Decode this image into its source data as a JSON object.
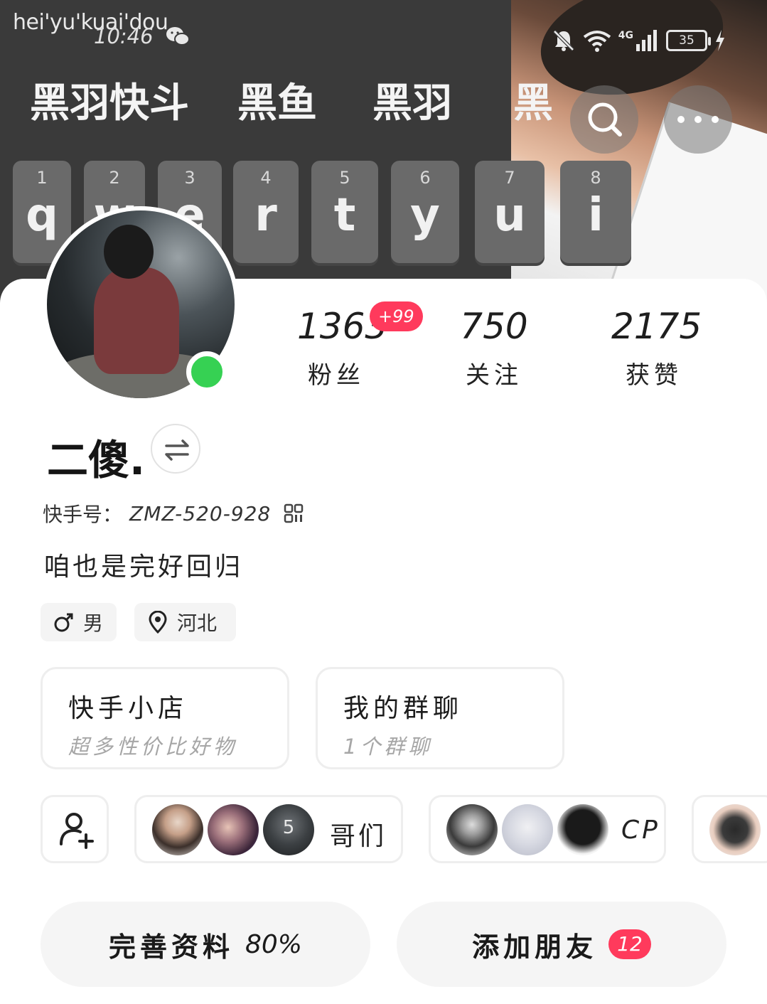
{
  "status_bar": {
    "carrier": "hei'yu'kuai'dou",
    "time": "10:46",
    "network": "4G",
    "battery": "35"
  },
  "header": {
    "hot_words": [
      "黑羽快斗",
      "黑鱼",
      "黑羽",
      "黑"
    ],
    "keyboard": [
      {
        "num": "1",
        "ch": "q"
      },
      {
        "num": "2",
        "ch": "w"
      },
      {
        "num": "3",
        "ch": "e"
      },
      {
        "num": "4",
        "ch": "r"
      },
      {
        "num": "5",
        "ch": "t"
      },
      {
        "num": "6",
        "ch": "y"
      },
      {
        "num": "7",
        "ch": "u"
      },
      {
        "num": "8",
        "ch": "i"
      }
    ]
  },
  "profile": {
    "stats": {
      "fans": {
        "value": "1363",
        "label": "粉丝",
        "badge": "+99"
      },
      "following": {
        "value": "750",
        "label": "关注"
      },
      "likes": {
        "value": "2175",
        "label": "获赞"
      }
    },
    "username": "二傻.",
    "uid_label": "快手号：",
    "uid_value": "ZMZ-520-928",
    "bio": "咱也是完好回归",
    "tags": {
      "gender": "男",
      "location": "河北"
    }
  },
  "entries": {
    "shop": {
      "title": "快手小店",
      "subtitle": "超多性价比好物"
    },
    "group": {
      "title": "我的群聊",
      "subtitle": "1个群聊"
    }
  },
  "circles": {
    "bros": {
      "label": "哥们",
      "avatar_count": "5"
    },
    "cp": {
      "label": "CP"
    }
  },
  "actions": {
    "complete_profile": {
      "label": "完善资料",
      "percent": "80%"
    },
    "add_friend": {
      "label": "添加朋友",
      "count": "12"
    }
  },
  "colors": {
    "accent_pink": "#ff3a5c",
    "online_green": "#36d153"
  },
  "icons": [
    "wechat-icon",
    "mute-icon",
    "wifi-icon",
    "signal-icon",
    "battery-icon",
    "charging-icon",
    "search-icon",
    "more-icon",
    "switch-icon",
    "qr-code-icon",
    "male-icon",
    "location-icon",
    "add-user-icon"
  ]
}
